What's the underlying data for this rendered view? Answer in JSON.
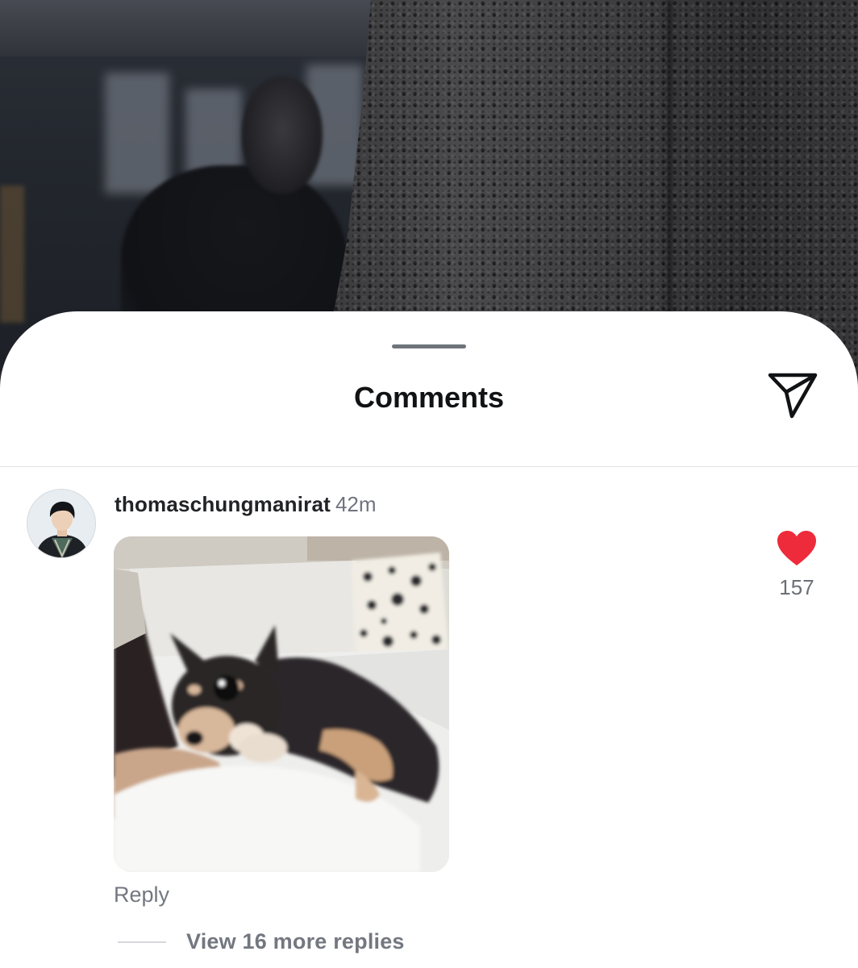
{
  "sheet": {
    "title": "Comments",
    "share_icon": "paper-plane-icon"
  },
  "comment": {
    "username": "thomaschungmanirat",
    "timestamp": "42m",
    "media_icon": "animated-gif-puppy",
    "like_icon": "heart-filled-icon",
    "like_count": "157",
    "reply_label": "Reply",
    "view_replies_label": "View 16 more replies"
  },
  "colors": {
    "heart": "#ee2b3b",
    "text_primary": "#111214",
    "text_secondary": "#737780",
    "sheet_background": "#ffffff"
  }
}
